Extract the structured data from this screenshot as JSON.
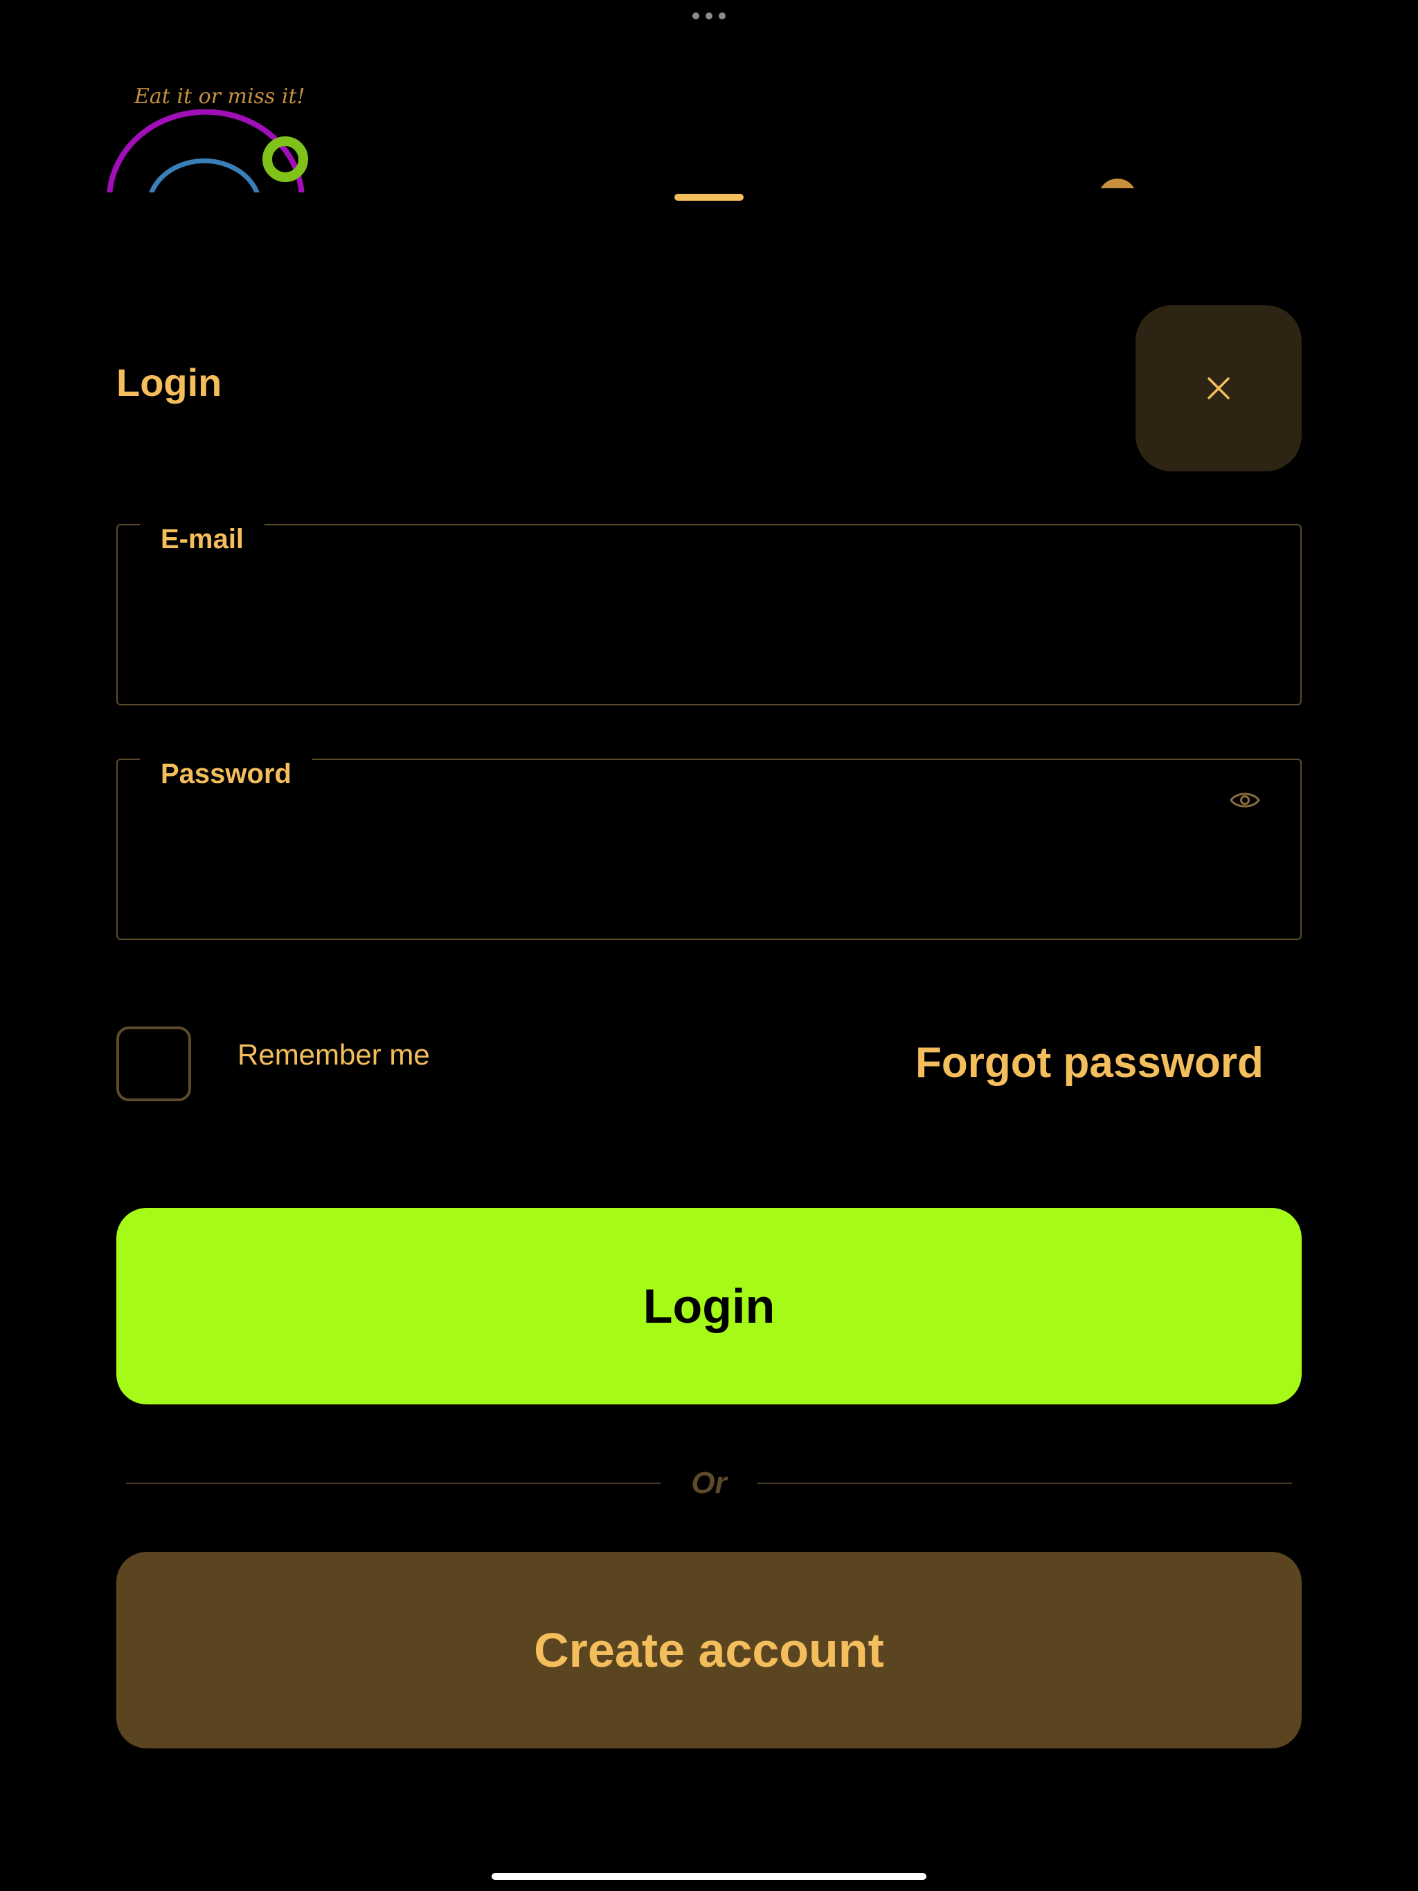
{
  "logo": {
    "tagline": "Eat it or miss it!"
  },
  "header": {
    "title": "Login",
    "close_icon": "close-icon"
  },
  "form": {
    "email": {
      "label": "E-mail",
      "value": ""
    },
    "password": {
      "label": "Password",
      "value": "",
      "toggle_icon": "eye-icon"
    },
    "remember_label": "Remember me",
    "remember_checked": false,
    "forgot_label": "Forgot password"
  },
  "actions": {
    "login_label": "Login",
    "divider_label": "Or",
    "create_account_label": "Create account"
  },
  "colors": {
    "background": "#000000",
    "accent": "#F5BE5C",
    "primary_button": "#A6FA17",
    "secondary_button": "#5A4520",
    "close_button_bg": "#2E2413",
    "border": "#5C4A2A"
  }
}
